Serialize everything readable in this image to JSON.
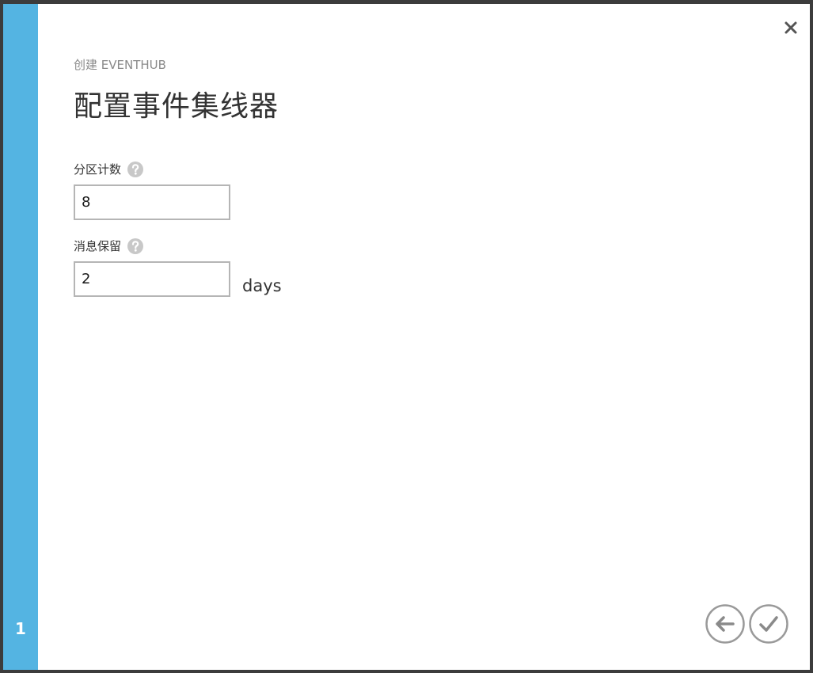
{
  "wizard": {
    "step_number": "1"
  },
  "header": {
    "subtitle": "创建 EVENTHUB",
    "title": "配置事件集线器"
  },
  "form": {
    "partition_count": {
      "label": "分区计数",
      "value": "8"
    },
    "message_retention": {
      "label": "消息保留",
      "value": "2",
      "unit": "days"
    }
  },
  "icons": {
    "close": "close-icon",
    "help": "question-mark-icon",
    "back": "arrow-left-icon",
    "complete": "checkmark-icon"
  },
  "colors": {
    "step_rail": "#54b4e2",
    "help_icon": "#c8c8c8",
    "nav_button": "#8a8a8a"
  }
}
